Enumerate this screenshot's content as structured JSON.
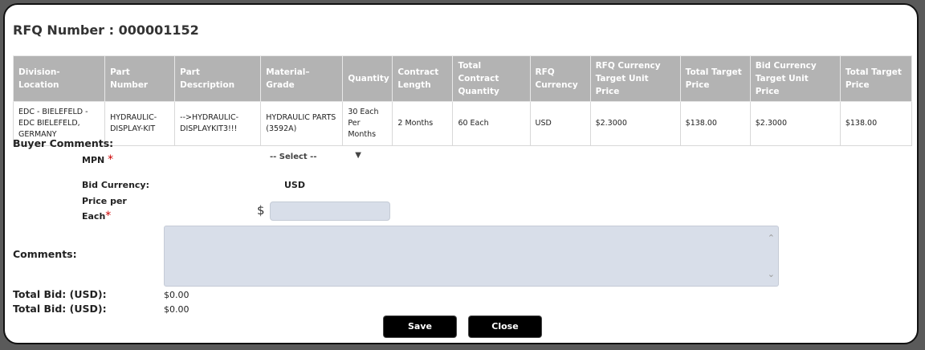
{
  "dialog": {
    "title": "RFQ Number : 000001152"
  },
  "table": {
    "headers": [
      "Division-Location",
      "Part Number",
      "Part Description",
      "Material–Grade",
      "Quantity",
      "Contract Length",
      "Total Contract Quantity",
      "RFQ Currency",
      "RFQ Currency Target Unit Price",
      "Total Target Price",
      "Bid Currency Target Unit Price",
      "Total Target Price"
    ],
    "rows": [
      [
        "EDC - BIELEFELD -EDC BIELEFELD, GERMANY",
        "HYDRAULIC-DISPLAY-KIT",
        "-->HYDRAULIC-DISPLAYKIT3!!!",
        "HYDRAULIC PARTS (3592A)",
        "30 Each Per Months",
        "2 Months",
        "60 Each",
        "USD",
        "$2.3000",
        "$138.00",
        "$2.3000",
        "$138.00"
      ]
    ]
  },
  "form": {
    "buyer_comments_label": "Buyer Comments:",
    "mpn_label": "MPN",
    "mpn_required": "*",
    "mpn_select_value": "-- Select --",
    "bid_currency_label": "Bid Currency:",
    "bid_currency_value": "USD",
    "price_label_line1": "Price per",
    "price_label_line2": "Each",
    "price_required": "*",
    "price_currency_symbol": "$",
    "price_value": "",
    "comments_label": "Comments:",
    "comments_value": "",
    "total_bid_label_1": "Total Bid: (USD):",
    "total_bid_value_1": "$0.00",
    "total_bid_label_2": "Total Bid: (USD):",
    "total_bid_value_2": "$0.00"
  },
  "buttons": {
    "save": "Save",
    "close": "Close"
  },
  "icons": {
    "select_arrow": "chevron-down-icon",
    "scroll_up": "chevron-up-icon",
    "scroll_down": "chevron-down-icon"
  }
}
